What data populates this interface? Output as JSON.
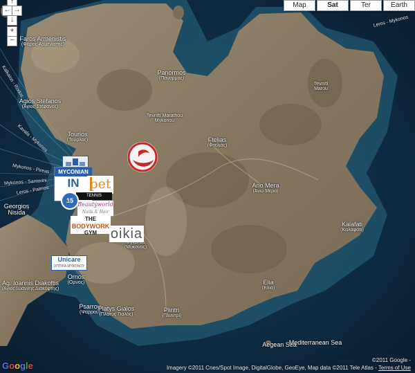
{
  "map_types": [
    {
      "label": "Map",
      "active": false
    },
    {
      "label": "Sat",
      "active": true
    },
    {
      "label": "Ter",
      "active": false
    },
    {
      "label": "Earth",
      "active": false
    }
  ],
  "zoom": {
    "plus": "+",
    "minus": "−"
  },
  "places": [
    {
      "main": "Faros Armenistis",
      "sub": "(Φάρος Αρμενιστής)"
    },
    {
      "main": "Agios Stefanos",
      "sub": "(Άγιος Στέφανος)"
    },
    {
      "main": "Tourlos",
      "sub": "(Τούρλος)"
    },
    {
      "main": "Panormos",
      "sub": "(Πάνορμος)"
    },
    {
      "main": "Tevnītī Marathou Mykonou",
      "sub": ""
    },
    {
      "main": "Ftelias",
      "sub": "(Φτελιάς)"
    },
    {
      "main": "Ano Mera",
      "sub": "(Άνω Μερά)"
    },
    {
      "main": "Kalafati",
      "sub": "(Καλαφάτι)"
    },
    {
      "main": "Georgios Nisida",
      "sub": ""
    },
    {
      "main": "Ornos",
      "sub": "(Ορνος)"
    },
    {
      "main": "Ag. Ioannis Diakoftis",
      "sub": "(Άγιος Ιωάννης Διακόφτης)"
    },
    {
      "main": "Psarrou",
      "sub": "(Ψαρρού)"
    },
    {
      "main": "Platys Gialos",
      "sub": "(Πλατύς Γιαλός)"
    },
    {
      "main": "Plintri",
      "sub": "(Πλυντρί)"
    },
    {
      "main": "Elia",
      "sub": "(Ελιά)"
    },
    {
      "main": "Mykonos",
      "sub": "(Μύκονος)"
    },
    {
      "main": "Tevnītī Marou",
      "sub": ""
    }
  ],
  "seas": [
    {
      "main": "Aegean Sea"
    },
    {
      "main": "Mediterranean Sea"
    }
  ],
  "routes": [
    {
      "text": "Kalkaios - Rodos"
    },
    {
      "text": "Kavala - Mykonos"
    },
    {
      "text": "Mykonos - Pireas"
    },
    {
      "text": "Mykonos - Santorini"
    },
    {
      "text": "Leros - Patmos"
    },
    {
      "text": "Leros - Mykonos"
    }
  ],
  "markers": {
    "myconian_top": "MYCONIAN",
    "myconian_big": "IN",
    "pet": "pet",
    "tennis": "TENNIS ACADEMY",
    "num15": "15",
    "beauty_main": "Beautyworld",
    "beauty_sub": "Nails & Hair",
    "body_top": "THE",
    "body_mid": "BODYWORK",
    "body_bot": "GYM",
    "oikia": "oikia",
    "unicare_main": "Unicare",
    "unicare_sub": "ΟΠΤΙΚΑ ΜΥΚΟΝΟΥ"
  },
  "attribution": {
    "line1": "©2011 Google -",
    "line2_prefix": "Imagery ©2011 Cnes/Spot Image, DigitalGlobe, GeoEye, Map data ©2011 Tele Atlas - ",
    "terms": "Terms of Use"
  },
  "google_logo": [
    "G",
    "o",
    "o",
    "g",
    "l",
    "e"
  ],
  "colors": {
    "land": "#8c7d66",
    "sea_deep": "#0e2b44",
    "sea_shallow": "#2f6f86"
  }
}
